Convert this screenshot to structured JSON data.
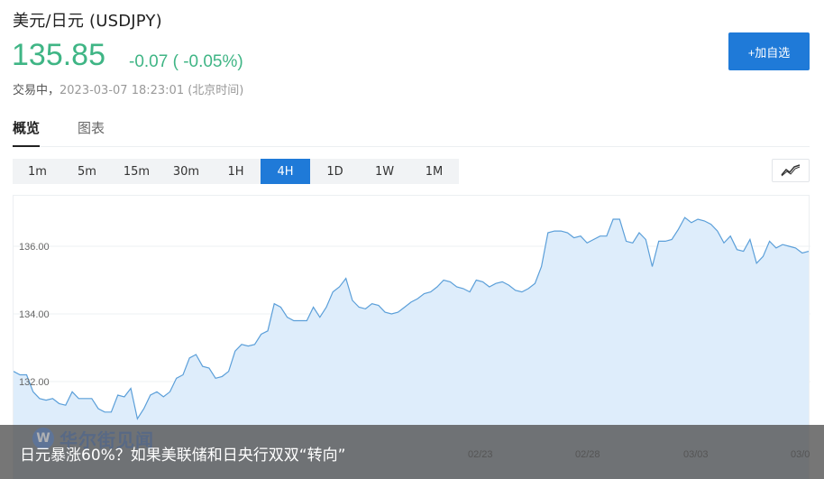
{
  "header": {
    "title": "美元/日元  (USDJPY)",
    "price": "135.85",
    "change": "-0.07 ( -0.05%)",
    "status": "交易中，",
    "timestamp": "2023-03-07 18:23:01 (北京时间)",
    "add_button": "+加自选"
  },
  "tabs": [
    {
      "label": "概览",
      "active": true
    },
    {
      "label": "图表",
      "active": false
    }
  ],
  "periods": [
    "1m",
    "5m",
    "15m",
    "30m",
    "1H",
    "4H",
    "1D",
    "1W",
    "1M"
  ],
  "active_period": "4H",
  "colors": {
    "accent": "#1f7ad8",
    "price_up_down": "#3fb585",
    "line": "#5b9fd9",
    "area": "#deedfb"
  },
  "chart_type_icon": "line-chart-icon",
  "chart_data": {
    "type": "area",
    "ylim": [
      131.0,
      137.3
    ],
    "y_ticks": [
      {
        "label": "132.00",
        "value": 132.0
      },
      {
        "label": "134.00",
        "value": 134.0
      },
      {
        "label": "136.00",
        "value": 136.0
      }
    ],
    "x_labels": [
      "02/23",
      "02/28",
      "03/03",
      "03/0"
    ],
    "values": [
      132.3,
      132.2,
      132.2,
      131.7,
      131.5,
      131.45,
      131.5,
      131.35,
      131.3,
      131.7,
      131.5,
      131.5,
      131.5,
      131.2,
      131.1,
      131.1,
      131.6,
      131.55,
      131.8,
      130.9,
      131.2,
      131.6,
      131.7,
      131.55,
      131.7,
      132.1,
      132.2,
      132.7,
      132.8,
      132.45,
      132.4,
      132.1,
      132.15,
      132.3,
      132.9,
      133.1,
      133.05,
      133.1,
      133.4,
      133.5,
      134.3,
      134.2,
      133.9,
      133.8,
      133.8,
      133.8,
      134.2,
      133.9,
      134.2,
      134.65,
      134.8,
      135.05,
      134.4,
      134.2,
      134.15,
      134.3,
      134.25,
      134.05,
      134.0,
      134.05,
      134.2,
      134.35,
      134.45,
      134.6,
      134.65,
      134.8,
      135.0,
      134.95,
      134.8,
      134.75,
      134.65,
      135.0,
      134.95,
      134.8,
      134.9,
      134.95,
      134.85,
      134.7,
      134.65,
      134.75,
      134.9,
      135.4,
      136.4,
      136.45,
      136.45,
      136.4,
      136.25,
      136.3,
      136.1,
      136.2,
      136.3,
      136.3,
      136.8,
      136.8,
      136.15,
      136.1,
      136.4,
      136.2,
      135.4,
      136.15,
      136.15,
      136.2,
      136.5,
      136.85,
      136.7,
      136.8,
      136.75,
      136.65,
      136.45,
      136.1,
      136.3,
      135.9,
      135.85,
      136.2,
      135.5,
      135.7,
      136.15,
      135.95,
      136.05,
      136.0,
      135.95,
      135.8,
      135.85
    ]
  },
  "news": {
    "watermark": "华尔街见闻",
    "headline": "日元暴涨60%？如果美联储和日央行双双“转向”"
  }
}
